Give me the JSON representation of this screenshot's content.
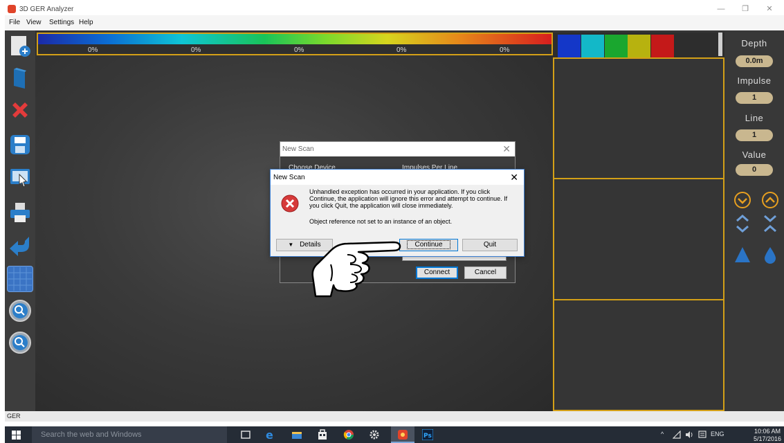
{
  "window": {
    "title": "3D GER Analyzer",
    "controls": {
      "minimize": "—",
      "restore": "❐",
      "close": "✕"
    }
  },
  "menu": [
    "File",
    "View",
    "Settings",
    "Help"
  ],
  "toolbar": {
    "items": [
      "new-scan",
      "open",
      "delete",
      "save",
      "touch-screen",
      "print",
      "back",
      "grid",
      "zoom-in",
      "zoom-out"
    ]
  },
  "color_scale": {
    "percentages": [
      "0%",
      "0%",
      "0%",
      "0%",
      "0%"
    ],
    "swatches": [
      "#1437c8",
      "#13b8c8",
      "#1aa72f",
      "#b7b20f",
      "#c41919"
    ]
  },
  "readouts": {
    "depth_label": "Depth",
    "depth_value": "0.0m",
    "impulse_label": "Impulse",
    "impulse_value": "1",
    "line_label": "Line",
    "line_value": "1",
    "value_label": "Value",
    "value_value": "0"
  },
  "dialog_back": {
    "title": "New Scan",
    "choose_device": "Choose Device",
    "impulses_per_line": "Impulses Per Line",
    "connect": "Connect",
    "cancel": "Cancel"
  },
  "dialog_error": {
    "title": "New Scan",
    "message": "Unhandled exception has occurred in your application. If you click Continue, the application will ignore this error and attempt to continue. If you click Quit, the application will close immediately.",
    "detail": "Object reference not set to an instance of an object.",
    "details_button": "Details",
    "continue_button": "Continue",
    "quit_button": "Quit"
  },
  "status": {
    "text": "GER"
  },
  "taskbar": {
    "search_placeholder": "Search the web and Windows",
    "language": "ENG",
    "time": "10:06 AM",
    "date": "5/17/2016"
  }
}
